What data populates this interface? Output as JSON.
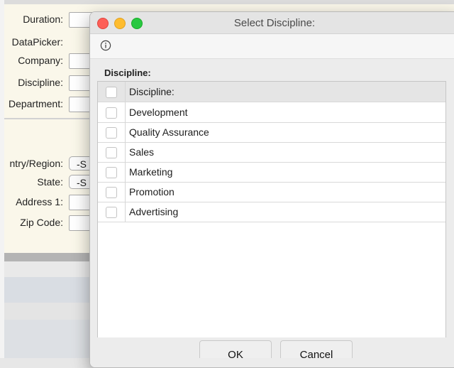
{
  "background_form": {
    "fields": [
      {
        "label": "Duration:",
        "type": "text"
      },
      {
        "label": "DataPicker:",
        "type": "none"
      },
      {
        "label": "Company:",
        "type": "text"
      },
      {
        "label": "Discipline:",
        "type": "text"
      },
      {
        "label": "Department:",
        "type": "text"
      },
      {
        "label": "ntry/Region:",
        "type": "select",
        "value": "-S"
      },
      {
        "label": "State:",
        "type": "select",
        "value": "-S"
      },
      {
        "label": "Address 1:",
        "type": "text"
      },
      {
        "label": "Zip Code:",
        "type": "text"
      }
    ]
  },
  "dialog": {
    "title": "Select Discipline:",
    "section_label": "Discipline:",
    "list_header": "Discipline:",
    "items": [
      "Development",
      "Quality Assurance",
      "Sales",
      "Marketing",
      "Promotion",
      "Advertising"
    ],
    "ok_label": "OK",
    "cancel_label": "Cancel"
  },
  "colors": {
    "close": "#fd5f57",
    "minimize": "#febc2e",
    "zoom": "#28c840",
    "form_panel": "#faf7ea"
  }
}
